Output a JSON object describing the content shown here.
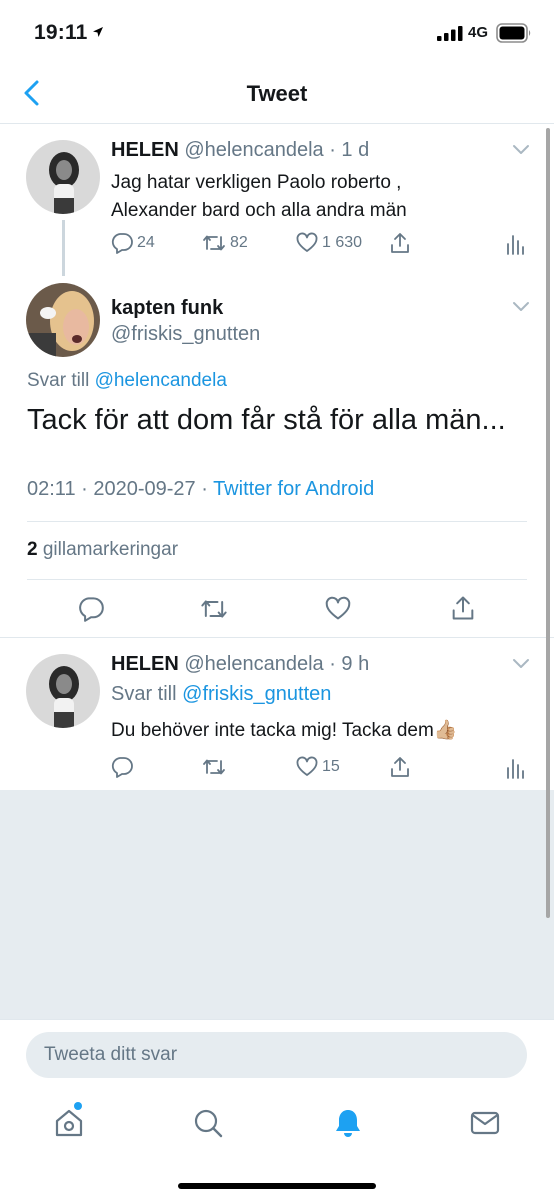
{
  "status_bar": {
    "time": "19:11",
    "network": "4G"
  },
  "header": {
    "title": "Tweet"
  },
  "tweet_parent": {
    "name": "HELEN",
    "handle": "@helencandela",
    "age": "· 1 d",
    "lines": [
      "Jag hatar verkligen Paolo roberto ,",
      "Alexander bard och alla andra män"
    ],
    "replies": "24",
    "retweets": "82",
    "likes": "1 630"
  },
  "tweet_main": {
    "name": "kapten funk",
    "handle": "@friskis_gnutten",
    "reply_prefix": "Svar till",
    "reply_to": "@helencandela",
    "text": "Tack för att dom får stå för alla män...",
    "timestamp": "02:11 · 2020-09-27 ·",
    "source": "Twitter for Android",
    "like_count": "2",
    "like_label": "gillamarkeringar"
  },
  "tweet_reply": {
    "name": "HELEN",
    "handle": "@helencandela",
    "age": "· 9 h",
    "reply_prefix": "Svar till",
    "reply_to": "@friskis_gnutten",
    "text": "Du behöver inte tacka mig! Tacka dem",
    "emoji": "👍🏼",
    "likes": "15"
  },
  "compose": {
    "placeholder": "Tweeta ditt svar"
  },
  "tabs": [
    "home-icon",
    "search-icon",
    "bell-icon",
    "mail-icon"
  ],
  "colors": {
    "accent": "#1da1f2",
    "link": "#1b95e0",
    "muted": "#657786",
    "background_gray": "#e6ecf0"
  }
}
